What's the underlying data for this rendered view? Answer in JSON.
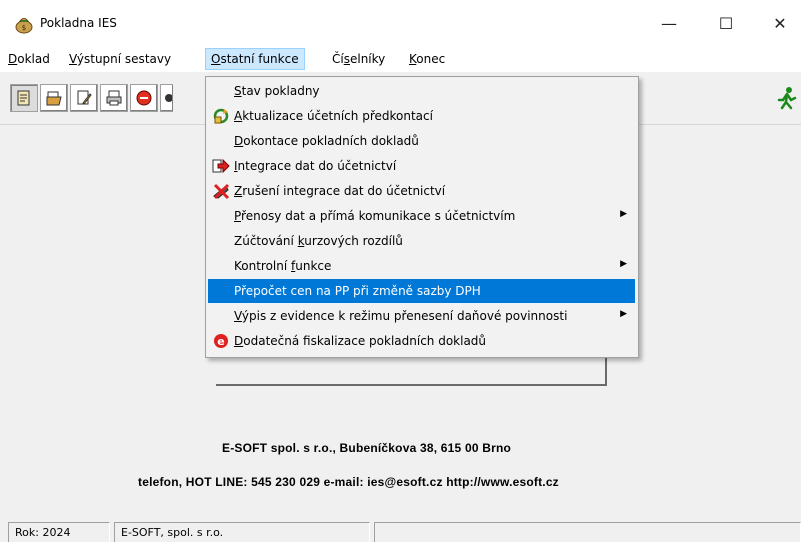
{
  "window": {
    "title": "Pokladna IES",
    "minimize_glyph": "—",
    "maximize_glyph": "☐",
    "close_glyph": "✕"
  },
  "menubar": {
    "items": [
      {
        "pre": "",
        "accel": "D",
        "post": "oklad"
      },
      {
        "pre": "",
        "accel": "V",
        "post": "ýstupní sestavy"
      },
      {
        "pre": "",
        "accel": "O",
        "post": "statní funkce"
      },
      {
        "pre": "Čí",
        "accel": "s",
        "post": "elníky"
      },
      {
        "pre": "",
        "accel": "K",
        "post": "onec"
      }
    ]
  },
  "toolbar": {
    "icons": [
      "document-icon",
      "folder-icon",
      "edit-document-icon",
      "printer-icon",
      "stop-icon",
      "info-icon",
      "exit-runner-icon"
    ]
  },
  "dropdown": {
    "items": [
      {
        "pre": "",
        "accel": "S",
        "post": "tav pokladny",
        "icon": "",
        "submenu": false
      },
      {
        "pre": "",
        "accel": "A",
        "post": "ktualizace účetních předkontací",
        "icon": "cycle-icon",
        "submenu": false
      },
      {
        "pre": "",
        "accel": "D",
        "post": "okontace pokladních dokladů",
        "icon": "",
        "submenu": false
      },
      {
        "pre": "",
        "accel": "I",
        "post": "ntegrace dat do účetnictví",
        "icon": "integrate-arrow-icon",
        "submenu": false
      },
      {
        "pre": "",
        "accel": "Z",
        "post": "rušení integrace dat do účetnictví",
        "icon": "cancel-integrate-icon",
        "submenu": false
      },
      {
        "pre": "",
        "accel": "P",
        "post": "řenosy dat a přímá komunikace s účetnictvím",
        "icon": "",
        "submenu": true
      },
      {
        "pre": "Zúčtování ",
        "accel": "k",
        "post": "urzových rozdílů",
        "icon": "",
        "submenu": false
      },
      {
        "pre": "Kontrolní ",
        "accel": "f",
        "post": "unkce",
        "icon": "",
        "submenu": true
      },
      {
        "pre": "Přepočet cen na PP při změně sazby DPH",
        "accel": "",
        "post": "",
        "icon": "",
        "submenu": false
      },
      {
        "pre": "",
        "accel": "V",
        "post": "ýpis z evidence k režimu přenesení daňové povinnosti",
        "icon": "",
        "submenu": true
      },
      {
        "pre": "",
        "accel": "D",
        "post": "odatečná fiskalizace pokladních dokladů",
        "icon": "fiscal-e-icon",
        "submenu": false
      }
    ],
    "highlighted_index": 8
  },
  "footer": {
    "line1": "E-SOFT spol. s r.o.,  Bubeníčkova 38, 615 00 Brno",
    "line2": "telefon, HOT LINE: 545 230 029  e-mail: ies@esoft.cz  http://www.esoft.cz"
  },
  "statusbar": {
    "year": "Rok: 2024",
    "company": "E-SOFT, spol. s r.o."
  },
  "colors": {
    "highlight": "#0078d7",
    "menu_open_bg": "#cce8ff"
  }
}
